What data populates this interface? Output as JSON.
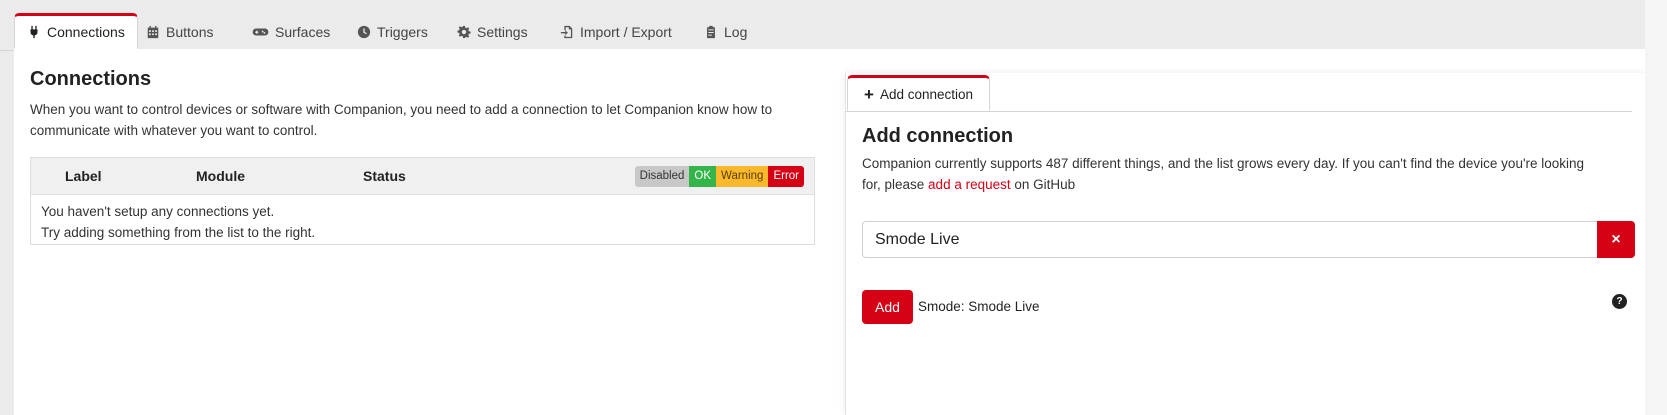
{
  "tabs": [
    {
      "label": "Connections",
      "icon": "plug-icon",
      "active": true
    },
    {
      "label": "Buttons",
      "icon": "calendar-grid-icon",
      "active": false
    },
    {
      "label": "Surfaces",
      "icon": "gamepad-icon",
      "active": false
    },
    {
      "label": "Triggers",
      "icon": "clock-icon",
      "active": false
    },
    {
      "label": "Settings",
      "icon": "gear-icon",
      "active": false
    },
    {
      "label": "Import / Export",
      "icon": "file-import-icon",
      "active": false
    },
    {
      "label": "Log",
      "icon": "clipboard-icon",
      "active": false
    }
  ],
  "connections": {
    "title": "Connections",
    "description_line1": "When you want to control devices or software with Companion, you need to add a connection to let Companion know how to",
    "description_line2": "communicate with whatever you want to control.",
    "table": {
      "columns": [
        "Label",
        "Module",
        "Status"
      ],
      "legend": {
        "disabled": "Disabled",
        "ok": "OK",
        "warning": "Warning",
        "error": "Error"
      },
      "empty_line1": "You haven't setup any connections yet.",
      "empty_line2": "Try adding something from the list to the right."
    }
  },
  "add_connection": {
    "tab_label": "Add connection",
    "title": "Add connection",
    "desc_line1": "Companion currently supports 487 different things, and the list grows every day. If you can't find the device you're looking",
    "desc_prefix": "for, please ",
    "desc_link": "add a request",
    "desc_suffix": " on GitHub",
    "search_value": "Smode Live",
    "clear_label": "×",
    "results": [
      {
        "button": "Add",
        "label": "Smode: Smode Live",
        "help": "?"
      }
    ]
  },
  "colors": {
    "accent": "#d50215",
    "ok": "#33b54a",
    "warning": "#fab92c",
    "disabled": "#c8c8c8"
  }
}
